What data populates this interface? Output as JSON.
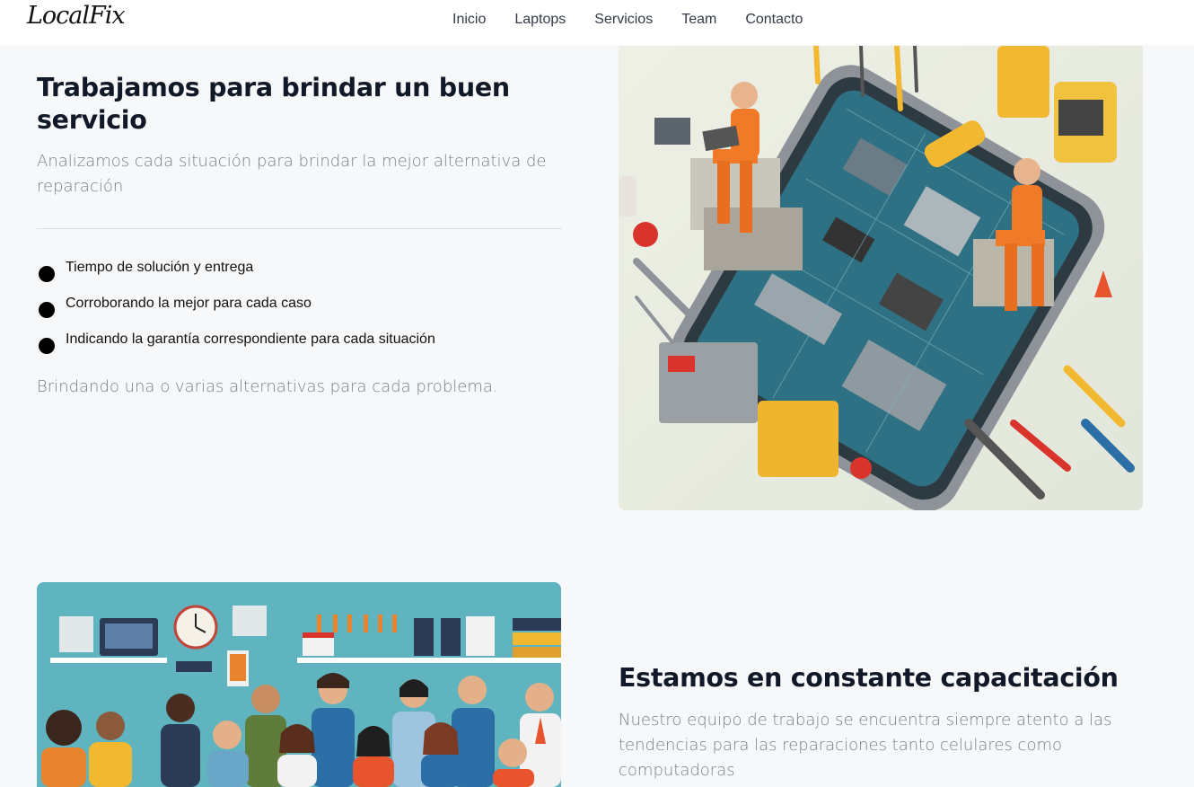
{
  "brand": {
    "logo_text": "LocalFix"
  },
  "nav": {
    "items": [
      {
        "label": "Inicio"
      },
      {
        "label": "Laptops"
      },
      {
        "label": "Servicios"
      },
      {
        "label": "Team"
      },
      {
        "label": "Contacto"
      }
    ]
  },
  "section1": {
    "title": "Trabajamos para brindar un buen servicio",
    "subtitle": "Analizamos cada situación para brindar la mejor alternativa de reparación",
    "features": [
      {
        "text": "Tiempo de solución y entrega"
      },
      {
        "text": "Corroborando la mejor para cada caso"
      },
      {
        "text": "Indicando la garantía correspondiente para cada situación"
      }
    ],
    "closing": "Brindando una o varias alternativas para cada problema."
  },
  "section2": {
    "title": "Estamos en constante capacitación",
    "subtitle": "Nuestro equipo de trabajo se encuentra siempre atento a las tendencias para las reparaciones tanto celulares como computadoras"
  },
  "colors": {
    "background": "#f7f8fa",
    "heading": "#111827",
    "muted_text": "#7a7f87",
    "accent_orange": "#f07a28",
    "board_teal": "#2e6f80"
  }
}
